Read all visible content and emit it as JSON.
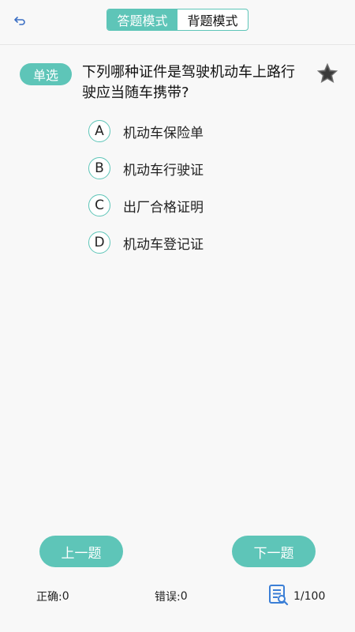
{
  "header": {
    "back_icon": "back-arrow-icon",
    "tabs": [
      {
        "label": "答题模式",
        "active": true
      },
      {
        "label": "背题模式",
        "active": false
      }
    ]
  },
  "question": {
    "type_label": "单选",
    "text": "下列哪种证件是驾驶机动车上路行驶应当随车携带?",
    "favorite_icon": "star-icon",
    "options": [
      {
        "letter": "A",
        "text": "机动车保险单"
      },
      {
        "letter": "B",
        "text": "机动车行驶证"
      },
      {
        "letter": "C",
        "text": "出厂合格证明"
      },
      {
        "letter": "D",
        "text": "机动车登记证"
      }
    ]
  },
  "navigation": {
    "prev_label": "上一题",
    "next_label": "下一题"
  },
  "footer": {
    "correct_label": "正确:",
    "correct_count": "0",
    "wrong_label": "错误:",
    "wrong_count": "0",
    "progress_icon": "question-list-icon",
    "progress_text": "1/100"
  },
  "colors": {
    "accent": "#5ec5b8",
    "background": "#f8f8f8"
  }
}
